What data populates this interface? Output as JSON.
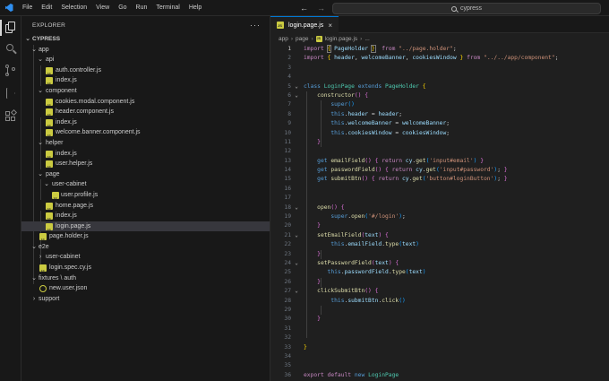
{
  "menu": [
    "File",
    "Edit",
    "Selection",
    "View",
    "Go",
    "Run",
    "Terminal",
    "Help"
  ],
  "nav": {
    "back": "←",
    "forward": "→"
  },
  "search": {
    "text": "cypress"
  },
  "explorer": {
    "title": "EXPLORER",
    "more": "···",
    "root": "CYPRESS",
    "items": [
      {
        "label": "app"
      },
      {
        "label": "api"
      },
      {
        "label": "auth.controller.js"
      },
      {
        "label": "index.js"
      },
      {
        "label": "component"
      },
      {
        "label": "cookies.modal.component.js"
      },
      {
        "label": "header.component.js"
      },
      {
        "label": "index.js"
      },
      {
        "label": "welcome.banner.component.js"
      },
      {
        "label": "helper"
      },
      {
        "label": "index.js"
      },
      {
        "label": "user.helper.js"
      },
      {
        "label": "page"
      },
      {
        "label": "user-cabinet"
      },
      {
        "label": "user.profile.js"
      },
      {
        "label": "home.page.js"
      },
      {
        "label": "index.js"
      },
      {
        "label": "login.page.js"
      },
      {
        "label": "page.holder.js"
      },
      {
        "label": "e2e"
      },
      {
        "label": "user-cabinet"
      },
      {
        "label": "login.spec.cy.js"
      },
      {
        "label": "fixtures \\ auth"
      },
      {
        "label": "new.user.json"
      },
      {
        "label": "support"
      }
    ]
  },
  "editor": {
    "tab_label": "login.page.js",
    "tab_close": "×",
    "breadcrumb": [
      "app",
      "page",
      "login.page.js",
      "..."
    ],
    "line_numbers": [
      "1",
      "2",
      "3",
      "4",
      "5",
      "6",
      "7",
      "8",
      "9",
      "10",
      "11",
      "12",
      "13",
      "14",
      "15",
      "16",
      "17",
      "18",
      "19",
      "20",
      "21",
      "22",
      "23",
      "24",
      "25",
      "26",
      "27",
      "28",
      "29",
      "30",
      "31",
      "32",
      "33",
      "34",
      "35",
      "36"
    ]
  },
  "colors": {
    "accent": "#0078d4",
    "background": "#1f1f1f",
    "sidebar": "#181818",
    "selection": "#37373d",
    "js_icon": "#cbcb41"
  }
}
